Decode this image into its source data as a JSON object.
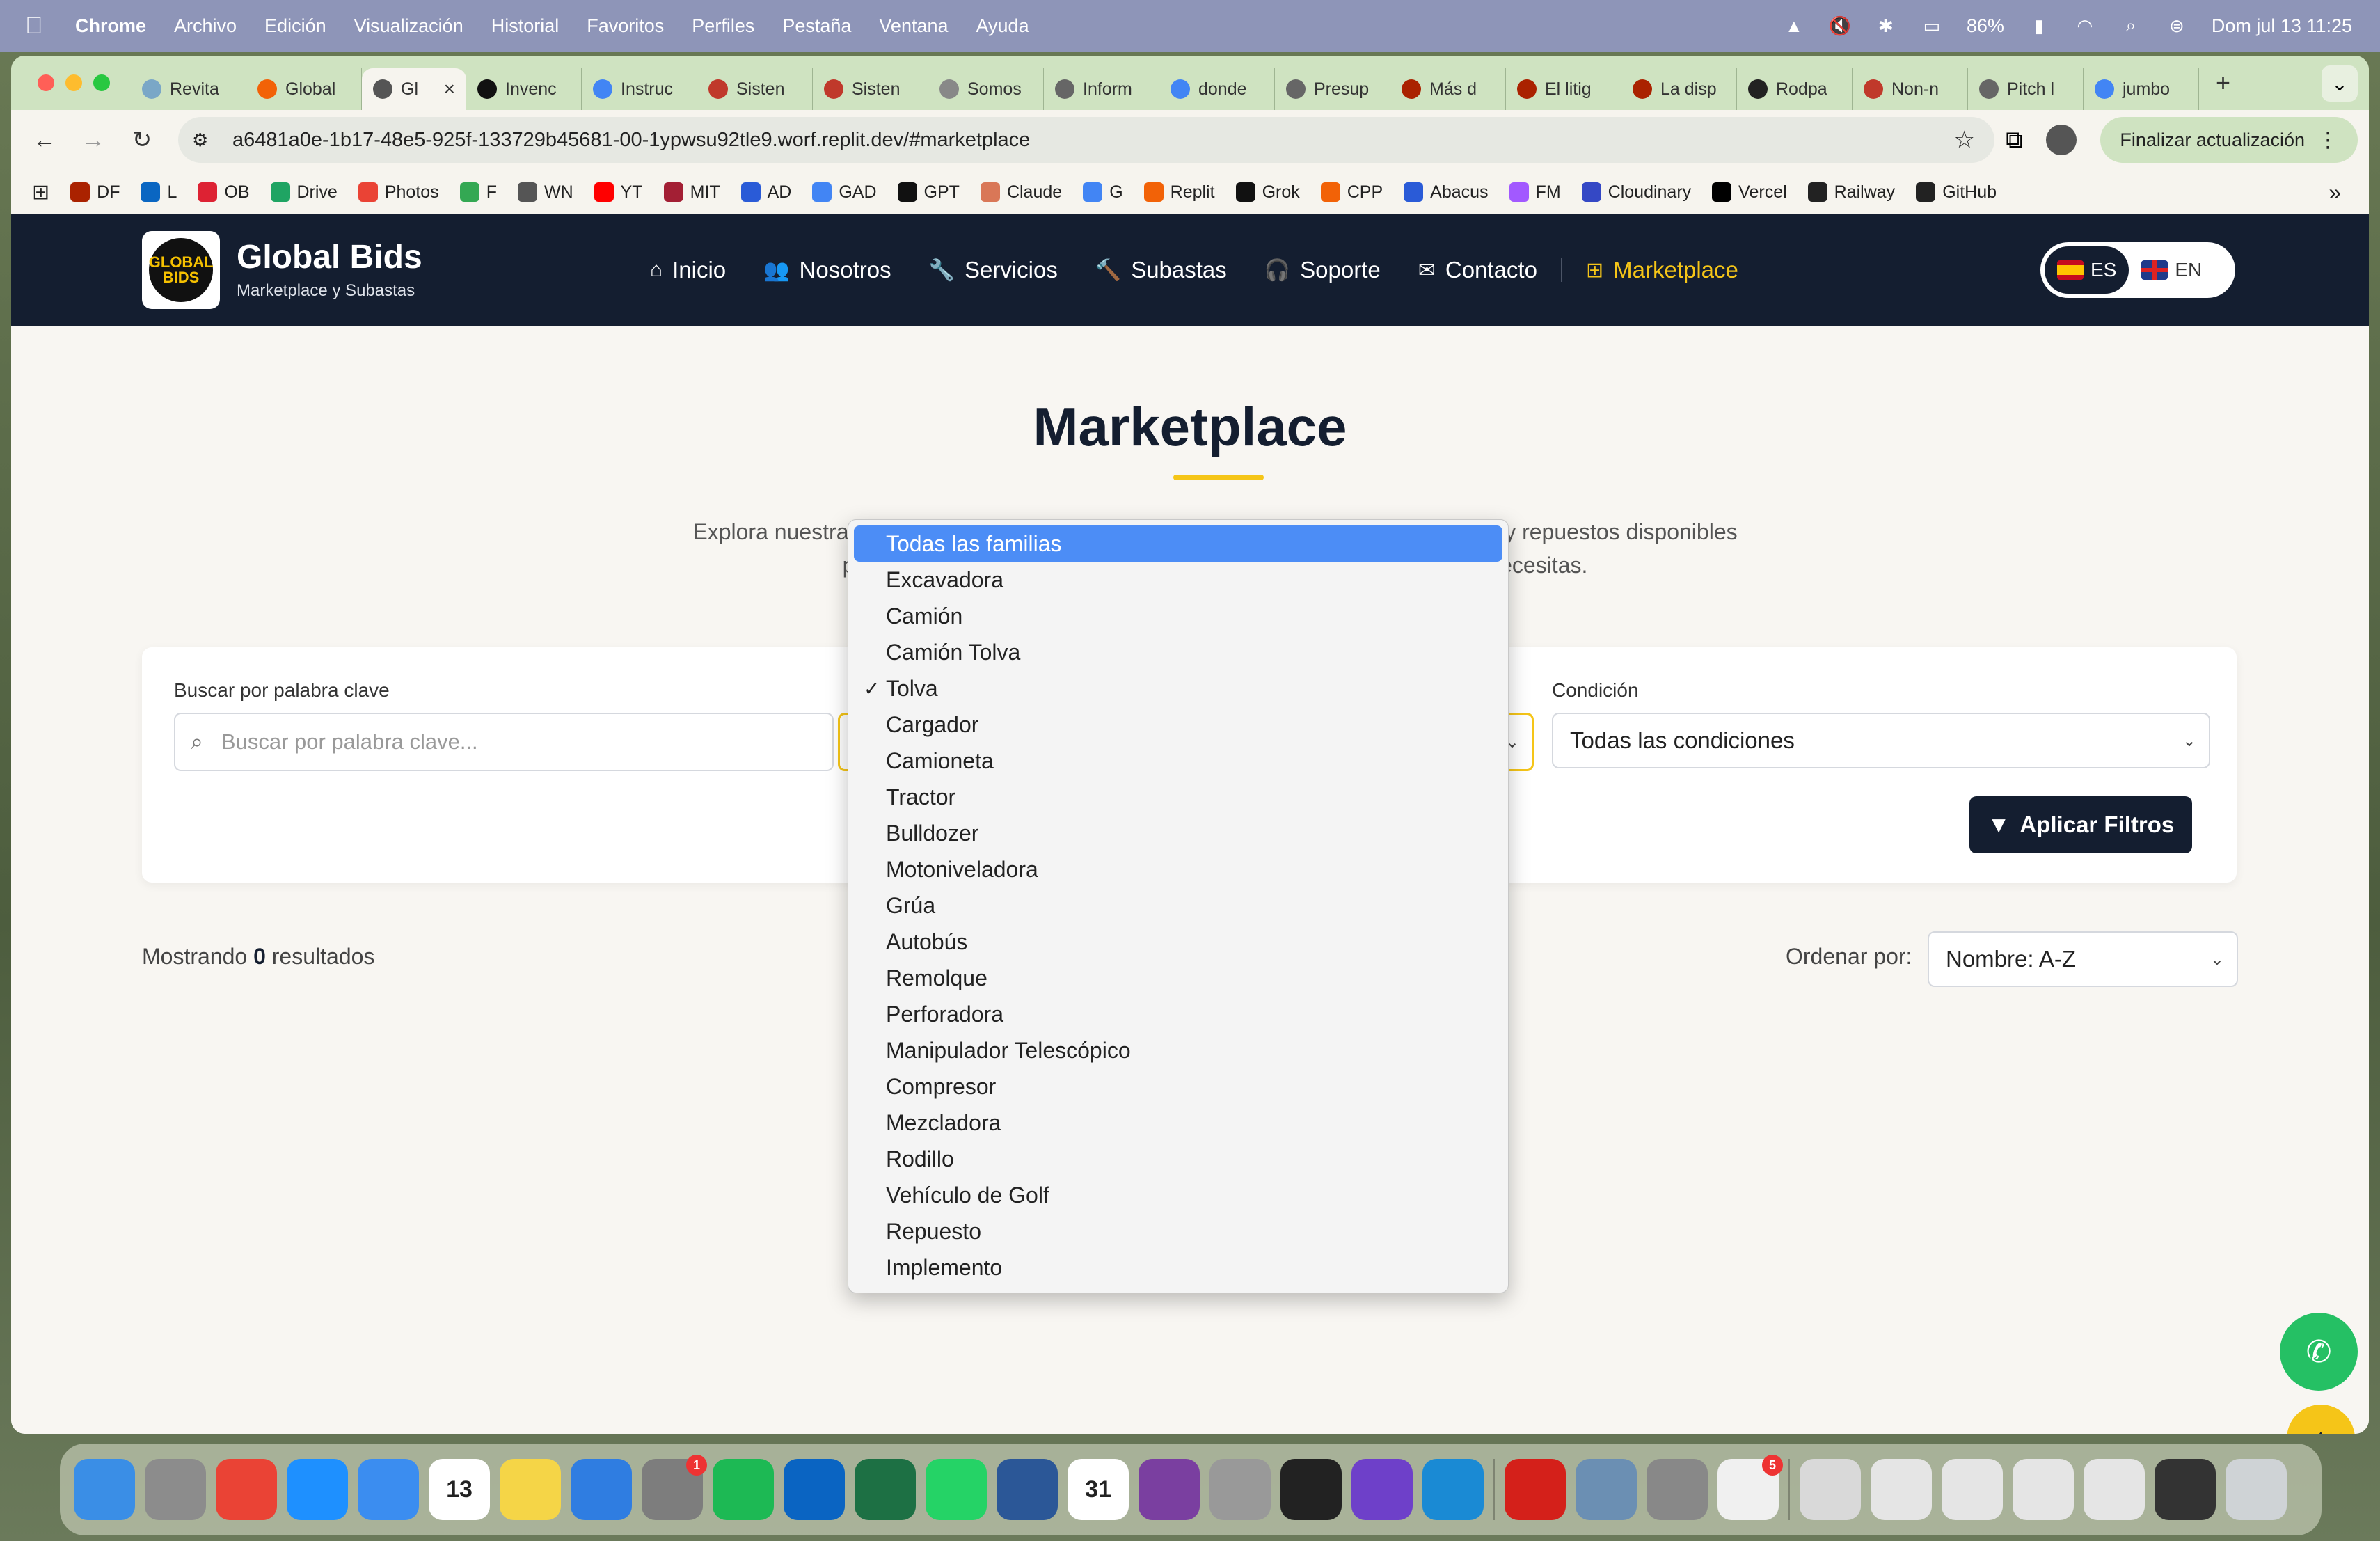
{
  "menubar": {
    "app": "Chrome",
    "items": [
      "Archivo",
      "Edición",
      "Visualización",
      "Historial",
      "Favoritos",
      "Perfiles",
      "Pestaña",
      "Ventana",
      "Ayuda"
    ],
    "battery": "86%",
    "clock": "Dom jul 13  11:25"
  },
  "tabs": [
    {
      "title": "Revita",
      "color": "#7aa7c7"
    },
    {
      "title": "Global",
      "color": "#f26207"
    },
    {
      "title": "Gl",
      "color": "#555555",
      "active": true
    },
    {
      "title": "Invenc",
      "color": "#111111"
    },
    {
      "title": "Instruc",
      "color": "#4285f4"
    },
    {
      "title": "Sisten",
      "color": "#c0392b"
    },
    {
      "title": "Sisten",
      "color": "#c0392b"
    },
    {
      "title": "Somos",
      "color": "#888888"
    },
    {
      "title": "Inform",
      "color": "#666666"
    },
    {
      "title": "donde",
      "color": "#4285f4"
    },
    {
      "title": "Presup",
      "color": "#666666"
    },
    {
      "title": "Más d",
      "color": "#aa2200"
    },
    {
      "title": "El litig",
      "color": "#aa2200"
    },
    {
      "title": "La disp",
      "color": "#aa2200"
    },
    {
      "title": "Rodpa",
      "color": "#222222"
    },
    {
      "title": "Non-n",
      "color": "#c0392b"
    },
    {
      "title": "Pitch l",
      "color": "#666666"
    },
    {
      "title": "jumbo",
      "color": "#4285f4"
    }
  ],
  "address": {
    "url": "a6481a0e-1b17-48e5-925f-133729b45681-00-1ypwsu92tle9.worf.replit.dev/#marketplace",
    "update_label": "Finalizar actualización"
  },
  "bookmarks": [
    {
      "label": "DF",
      "color": "#aa2200"
    },
    {
      "label": "L",
      "color": "#0a66c2"
    },
    {
      "label": "OB",
      "color": "#d23"
    },
    {
      "label": "Drive",
      "color": "#1fa463"
    },
    {
      "label": "Photos",
      "color": "#ea4335"
    },
    {
      "label": "F",
      "color": "#34a853"
    },
    {
      "label": "WN",
      "color": "#555555"
    },
    {
      "label": "YT",
      "color": "#ff0000"
    },
    {
      "label": "MIT",
      "color": "#a31f34"
    },
    {
      "label": "AD",
      "color": "#2a5bd7"
    },
    {
      "label": "GAD",
      "color": "#4285f4"
    },
    {
      "label": "GPT",
      "color": "#111111"
    },
    {
      "label": "Claude",
      "color": "#d97757"
    },
    {
      "label": "G",
      "color": "#4285f4"
    },
    {
      "label": "Replit",
      "color": "#f26207"
    },
    {
      "label": "Grok",
      "color": "#111111"
    },
    {
      "label": "CPP",
      "color": "#f26207"
    },
    {
      "label": "Abacus",
      "color": "#2a5bd7"
    },
    {
      "label": "FM",
      "color": "#a259ff"
    },
    {
      "label": "Cloudinary",
      "color": "#3448c5"
    },
    {
      "label": "Vercel",
      "color": "#000000"
    },
    {
      "label": "Railway",
      "color": "#222222"
    },
    {
      "label": "GitHub",
      "color": "#222222"
    }
  ],
  "site": {
    "logo_text": "GLOBAL BIDS",
    "brand": "Global Bids",
    "brand_sub": "Marketplace y Subastas",
    "nav": [
      {
        "label": "Inicio",
        "icon": "⌂"
      },
      {
        "label": "Nosotros",
        "icon": "👥"
      },
      {
        "label": "Servicios",
        "icon": "🔧"
      },
      {
        "label": "Subastas",
        "icon": "🔨"
      },
      {
        "label": "Soporte",
        "icon": "🎧"
      },
      {
        "label": "Contacto",
        "icon": "✉"
      },
      {
        "label": "Marketplace",
        "icon": "⊞",
        "active": true
      }
    ],
    "lang_es": "ES",
    "lang_en": "EN"
  },
  "page": {
    "title": "Marketplace",
    "desc_line1": "Explora nuestra amplia selección de maquinaria industrial, chatarra, herramientas y repuestos disponibles",
    "desc_line2": "para remate. Utiliza los filtros para encontrar exactamente lo que necesitas."
  },
  "filters": {
    "keyword_label": "Buscar por palabra clave",
    "keyword_placeholder": "Buscar por palabra clave...",
    "condition_label": "Condición",
    "condition_value": "Todas las condiciones",
    "apply_label": "Aplicar Filtros"
  },
  "results": {
    "prefix": "Mostrando",
    "count": "0",
    "suffix": "resultados",
    "sort_label": "Ordenar por:",
    "sort_value": "Nombre: A-Z"
  },
  "family_dropdown": {
    "highlighted": "Todas las familias",
    "selected": "Tolva",
    "options": [
      "Todas las familias",
      "Excavadora",
      "Camión",
      "Camión Tolva",
      "Tolva",
      "Cargador",
      "Camioneta",
      "Tractor",
      "Bulldozer",
      "Motoniveladora",
      "Grúa",
      "Autobús",
      "Remolque",
      "Perforadora",
      "Manipulador Telescópico",
      "Compresor",
      "Mezcladora",
      "Rodillo",
      "Vehículo de Golf",
      "Repuesto",
      "Implemento"
    ]
  },
  "dock": [
    {
      "name": "finder",
      "color": "#3a8ee6"
    },
    {
      "name": "launchpad",
      "color": "#8c8c8c"
    },
    {
      "name": "chrome",
      "color": "#ea4335"
    },
    {
      "name": "safari",
      "color": "#1e90ff"
    },
    {
      "name": "mail",
      "color": "#3b8df0"
    },
    {
      "name": "calendar",
      "color": "#ffffff",
      "text": "13"
    },
    {
      "name": "notes",
      "color": "#f5d547"
    },
    {
      "name": "keynote",
      "color": "#2f7de1"
    },
    {
      "name": "system-settings",
      "color": "#7d7d7d",
      "badge": "1"
    },
    {
      "name": "spotify",
      "color": "#1db954"
    },
    {
      "name": "outlook",
      "color": "#0a64c2"
    },
    {
      "name": "excel",
      "color": "#1d7044"
    },
    {
      "name": "whatsapp",
      "color": "#25d366"
    },
    {
      "name": "word",
      "color": "#2b5797"
    },
    {
      "name": "fantastical",
      "color": "#ffffff",
      "text": "31"
    },
    {
      "name": "screen-recorder",
      "color": "#7a3fa0"
    },
    {
      "name": "iphone-mirroring",
      "color": "#999999"
    },
    {
      "name": "replit",
      "color": "#222222"
    },
    {
      "name": "github-desktop",
      "color": "#6e40c9"
    },
    {
      "name": "vscode",
      "color": "#1a8ad4"
    },
    {
      "name": "acrobat",
      "color": "#d4201a"
    },
    {
      "name": "preview",
      "color": "#6b8fb3"
    },
    {
      "name": "pro-app",
      "color": "#888888"
    },
    {
      "name": "app-store-updates",
      "color": "#f0f0f0",
      "badge": "5"
    },
    {
      "name": "recent-doc-1",
      "color": "#d9d9d9"
    },
    {
      "name": "recent-doc-2",
      "color": "#e5e5e5"
    },
    {
      "name": "recent-doc-3",
      "color": "#e5e5e5"
    },
    {
      "name": "recent-doc-4",
      "color": "#e5e5e5"
    },
    {
      "name": "recent-doc-5",
      "color": "#e5e5e5"
    },
    {
      "name": "terminal-window",
      "color": "#333333"
    },
    {
      "name": "trash",
      "color": "#cfd3d6"
    }
  ]
}
